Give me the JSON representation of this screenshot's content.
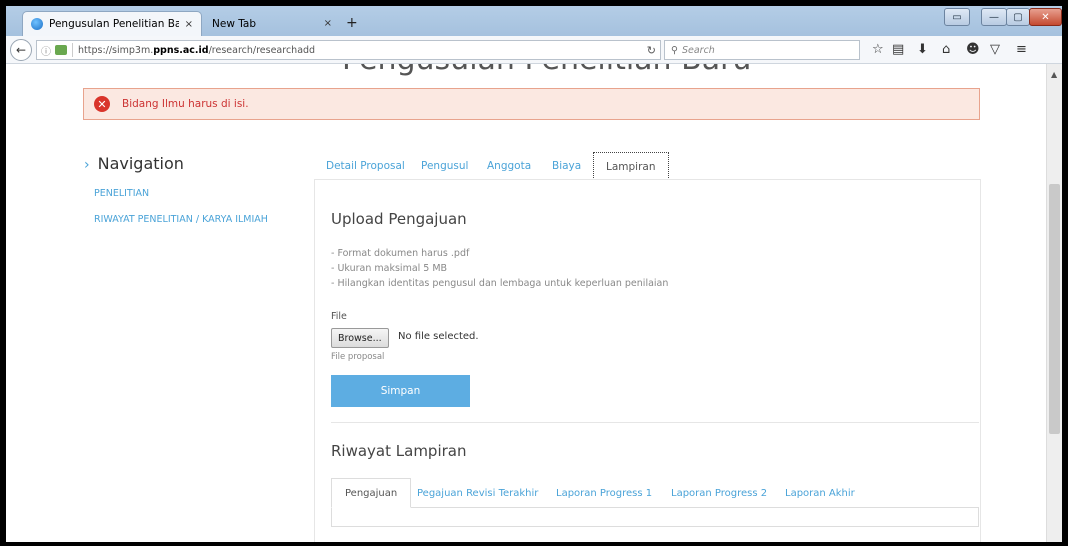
{
  "browser": {
    "active_tab_title": "Pengusulan Penelitian Bar...",
    "close_glyph": "×",
    "new_tab_title": "New Tab",
    "url_host_prefix": "https://simp3m.",
    "url_host_bold": "ppns.ac.id",
    "url_path": "/research/researchadd",
    "search_placeholder": "Search"
  },
  "page": {
    "title": "Pengusulan Penelitian Baru",
    "alert_message": "Bidang Ilmu harus di isi."
  },
  "navigation": {
    "heading": "Navigation",
    "items": [
      {
        "label": "PENELITIAN"
      },
      {
        "label": "RIWAYAT PENELITIAN / KARYA ILMIAH"
      }
    ]
  },
  "tabs": [
    {
      "label": "Detail Proposal"
    },
    {
      "label": "Pengusul"
    },
    {
      "label": "Anggota"
    },
    {
      "label": "Biaya"
    },
    {
      "label": "Lampiran",
      "active": true
    }
  ],
  "upload": {
    "title": "Upload Pengajuan",
    "requirements": [
      "- Format dokumen harus .pdf",
      "- Ukuran maksimal 5 MB",
      "- Hilangkan identitas pengusul dan lembaga untuk keperluan penilaian"
    ],
    "file_label": "File",
    "browse_label": "Browse...",
    "no_file_text": "No file selected.",
    "file_hint": "File proposal",
    "submit_label": "Simpan"
  },
  "riwayat": {
    "title": "Riwayat Lampiran",
    "tabs": [
      {
        "label": "Pengajuan",
        "active": true
      },
      {
        "label": "Pegajuan Revisi Terakhir"
      },
      {
        "label": "Laporan Progress 1"
      },
      {
        "label": "Laporan Progress 2"
      },
      {
        "label": "Laporan Akhir"
      }
    ]
  },
  "colors": {
    "link": "#4aa3d8",
    "button": "#5dade2",
    "alert_bg": "#fbe8e1",
    "alert_border": "#e8a38d",
    "error_icon": "#d9342b"
  }
}
